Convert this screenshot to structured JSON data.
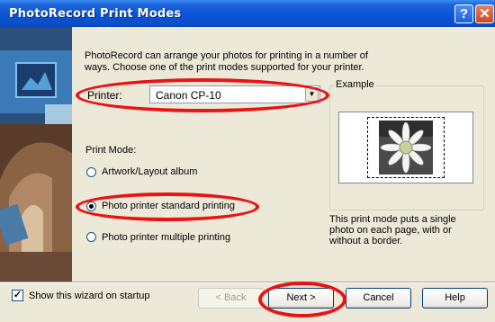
{
  "window": {
    "title": "PhotoRecord Print Modes",
    "help_label": "?",
    "close_label": "✕"
  },
  "intro": {
    "line1": "PhotoRecord can arrange your photos for printing in a number of",
    "line2": "ways. Choose one of the print modes supported for your printer."
  },
  "printer": {
    "label": "Printer:",
    "value": "Canon CP-10"
  },
  "print_mode": {
    "label": "Print Mode:",
    "options": [
      {
        "label": "Artwork/Layout album",
        "selected": false
      },
      {
        "label": "Photo printer standard printing",
        "selected": true
      },
      {
        "label": "Photo printer multiple printing",
        "selected": false
      }
    ]
  },
  "example": {
    "label": "Example",
    "desc_line1": "This print mode puts a single",
    "desc_line2": "photo on each page, with or",
    "desc_line3": "without a border."
  },
  "wizard": {
    "show_on_startup_label": "Show this wizard on startup",
    "checked": true,
    "check_glyph": "✓"
  },
  "buttons": {
    "back": "< Back",
    "next": "Next >",
    "cancel": "Cancel",
    "help": "Help"
  },
  "colors": {
    "title_bar": "#0a54d6",
    "dialog_bg": "#ece9d8",
    "annotation": "#e81414"
  }
}
